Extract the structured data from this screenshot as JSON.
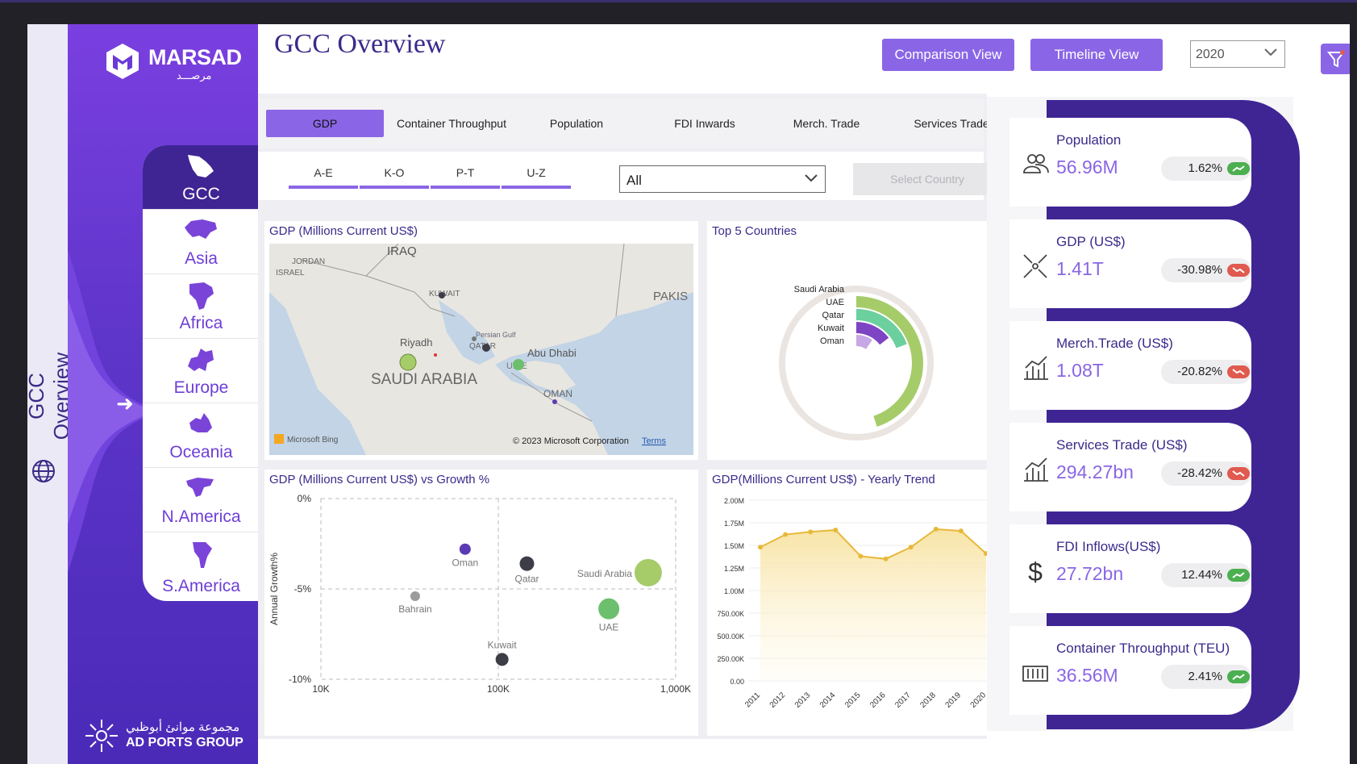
{
  "page": {
    "title": "GCC Overview"
  },
  "sidebar": {
    "vertical_title": "GCC Overview",
    "brand": "MARSAD",
    "brand_ar": "مرصـــد",
    "regions": [
      {
        "label": "GCC",
        "active": true
      },
      {
        "label": "Asia"
      },
      {
        "label": "Africa"
      },
      {
        "label": "Europe"
      },
      {
        "label": "Oceania"
      },
      {
        "label": "N.America"
      },
      {
        "label": "S.America"
      }
    ],
    "footer_ar": "مجموعة موانئ أبوظبي",
    "footer_en": "AD PORTS GROUP"
  },
  "header": {
    "comparison_label": "Comparison View",
    "timeline_label": "Timeline View",
    "year": "2020"
  },
  "tabs": [
    "GDP",
    "Container Throughput",
    "Population",
    "FDI Inwards",
    "Merch. Trade",
    "Services Trade"
  ],
  "letter_filters": [
    "A-E",
    "K-O",
    "P-T",
    "U-Z"
  ],
  "country_dropdown": "All",
  "select_country_label": "Select Country",
  "map": {
    "title": "GDP (Millions Current US$)",
    "labels": [
      "IRAQ",
      "JORDAN",
      "ISRAEL",
      "KUWAIT",
      "Persian Gulf",
      "QATAR",
      "Riyadh",
      "Abu Dhabi",
      "SAUDI ARABIA",
      "U.AE",
      "OMAN",
      "PAKIS"
    ],
    "credit": "Microsoft Bing",
    "copyright": "© 2023 Microsoft Corporation",
    "terms": "Terms"
  },
  "top5": {
    "title": "Top 5 Countries"
  },
  "scatter": {
    "title": "GDP (Millions Current US$) vs Growth %"
  },
  "line": {
    "title": "GDP(Millions Current US$) - Yearly Trend"
  },
  "chart_data": [
    {
      "type": "radial_bar",
      "title": "Top 5 Countries",
      "categories": [
        "Saudi Arabia",
        "UAE",
        "Qatar",
        "Kuwait",
        "Oman"
      ],
      "values": [
        700,
        420,
        180,
        135,
        90
      ],
      "colors": [
        "#e8e2df",
        "#a6cc6a",
        "#6ccf9e",
        "#7d44c4",
        "#c7a7e6"
      ]
    },
    {
      "type": "scatter",
      "title": "GDP (Millions Current US$) vs Growth %",
      "xlabel": "",
      "ylabel": "Annual Growth%",
      "x_scale": "log",
      "xlim": [
        10000,
        1000000
      ],
      "ylim": [
        -10,
        0
      ],
      "x_ticks": [
        "10K",
        "100K",
        "1,000K"
      ],
      "y_ticks": [
        "0%",
        "-5%",
        "-10%"
      ],
      "points": [
        {
          "label": "Oman",
          "x": 65000,
          "y": -2.8,
          "color": "#5b3bb3",
          "r": 7
        },
        {
          "label": "Qatar",
          "x": 145000,
          "y": -3.6,
          "color": "#3d3d48",
          "r": 9
        },
        {
          "label": "Saudi Arabia",
          "x": 700000,
          "y": -4.1,
          "color": "#a6cc6a",
          "r": 17
        },
        {
          "label": "Bahrain",
          "x": 34000,
          "y": -5.4,
          "color": "#9b9b9b",
          "r": 6
        },
        {
          "label": "UAE",
          "x": 420000,
          "y": -6.1,
          "color": "#6cbf6c",
          "r": 13
        },
        {
          "label": "Kuwait",
          "x": 105000,
          "y": -8.9,
          "color": "#3d3d48",
          "r": 8
        }
      ]
    },
    {
      "type": "line",
      "title": "GDP(Millions Current US$) - Yearly Trend",
      "x": [
        "2011",
        "2012",
        "2013",
        "2014",
        "2015",
        "2016",
        "2017",
        "2018",
        "2019",
        "2020"
      ],
      "values": [
        1480000,
        1620000,
        1650000,
        1670000,
        1380000,
        1350000,
        1480000,
        1680000,
        1660000,
        1410000
      ],
      "ylim": [
        0,
        2000000
      ],
      "y_ticks": [
        "0.00",
        "250.00K",
        "500.00K",
        "750.00K",
        "1.00M",
        "1.25M",
        "1.50M",
        "1.75M",
        "2.00M"
      ],
      "color": "#e8b83a"
    }
  ],
  "kpis": [
    {
      "label": "Population",
      "value": "56.96M",
      "change": "1.62%",
      "trend": "up",
      "icon": "people-icon"
    },
    {
      "label": "GDP (US$)",
      "value": "1.41T",
      "change": "-30.98%",
      "trend": "down",
      "icon": "compress-icon"
    },
    {
      "label": "Merch.Trade (US$)",
      "value": "1.08T",
      "change": "-20.82%",
      "trend": "down",
      "icon": "chart-up-icon"
    },
    {
      "label": "Services Trade (US$)",
      "value": "294.27bn",
      "change": "-28.42%",
      "trend": "down",
      "icon": "chart-up-icon"
    },
    {
      "label": "FDI Inflows(US$)",
      "value": "27.72bn",
      "change": "12.44%",
      "trend": "up",
      "icon": "dollar-icon"
    },
    {
      "label": "Container Throughput (TEU)",
      "value": "36.56M",
      "change": "2.41%",
      "trend": "up",
      "icon": "container-icon"
    }
  ],
  "colors": {
    "accent": "#8a66e6",
    "dark": "#3f2594",
    "up": "#4caf50",
    "down": "#e05a4f"
  }
}
